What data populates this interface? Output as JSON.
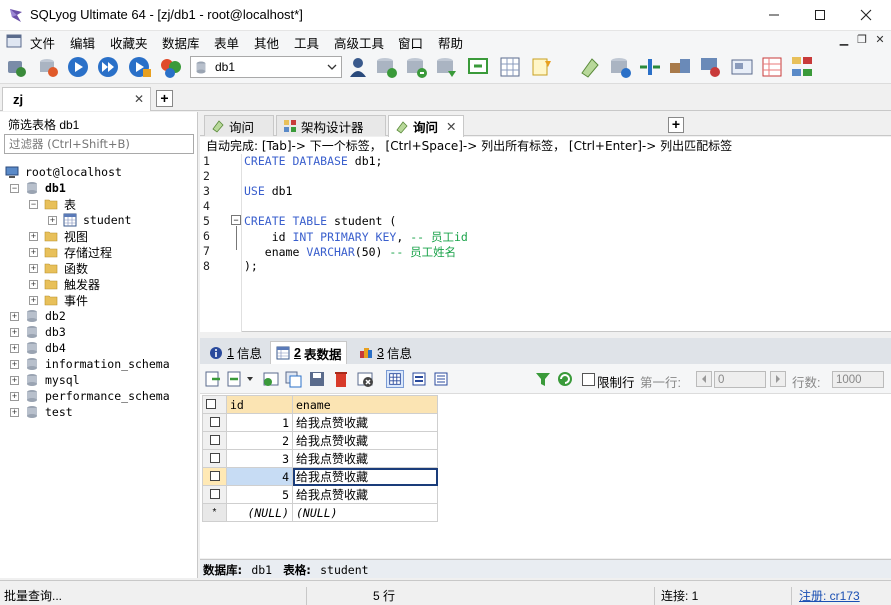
{
  "window": {
    "title": "SQLyog Ultimate 64 - [zj/db1 - root@localhost*]"
  },
  "menu": [
    "文件",
    "编辑",
    "收藏夹",
    "数据库",
    "表单",
    "其他",
    "工具",
    "高级工具",
    "窗口",
    "帮助"
  ],
  "toolbar": {
    "database_select": "db1"
  },
  "connection_tab": {
    "label": "zj",
    "close": "✕",
    "add": "+"
  },
  "object_browser": {
    "filter_label": "筛选表格 db1",
    "filter_placeholder": "过滤器 (Ctrl+Shift+B)",
    "root": "root@localhost",
    "db1": "db1",
    "folder_tables": "表",
    "table_student": "student",
    "folder_views": "视图",
    "folder_procs": "存储过程",
    "folder_funcs": "函数",
    "folder_triggers": "触发器",
    "folder_events": "事件",
    "databases": [
      "db2",
      "db3",
      "db4",
      "information_schema",
      "mysql",
      "performance_schema",
      "test"
    ]
  },
  "query_tabs": {
    "tab1": "询问",
    "tab2": "架构设计器",
    "tab3": "询问",
    "add": "+"
  },
  "autocomplete_hint": "自动完成:  [Tab]-> 下一个标签，  [Ctrl+Space]-> 列出所有标签，  [Ctrl+Enter]-> 列出匹配标签",
  "editor": {
    "line_numbers": [
      "1",
      "2",
      "3",
      "4",
      "5",
      "6",
      "7",
      "8"
    ],
    "lines": {
      "l1_kw": "CREATE DATABASE",
      "l1_rest": " db1;",
      "l3_kw": "USE",
      "l3_rest": " db1",
      "l5_kw": "CREATE TABLE",
      "l5_rest": " student (",
      "l6_a": "    id ",
      "l6_kw": "INT PRIMARY KEY",
      "l6_b": ", ",
      "l6_cm": "-- 员工id",
      "l7_a": "   ename ",
      "l7_kw": "VARCHAR",
      "l7_b": "(50) ",
      "l7_cm": "-- 员工姓名",
      "l8": ");"
    }
  },
  "result_tabs": {
    "t1_num": "1",
    "t1_label": "信息",
    "t2_num": "2",
    "t2_label": "表数据",
    "t3_num": "3",
    "t3_label": "信息"
  },
  "result_toolbar": {
    "limit_rows": "限制行",
    "first_row_label": "第一行:",
    "first_row_value": "0",
    "rows_label": "行数:",
    "rows_value": "1000"
  },
  "grid": {
    "columns": [
      "id",
      "ename"
    ],
    "rows": [
      {
        "id": "1",
        "ename": "给我点赞收藏"
      },
      {
        "id": "2",
        "ename": "给我点赞收藏"
      },
      {
        "id": "3",
        "ename": "给我点赞收藏"
      },
      {
        "id": "4",
        "ename": "给我点赞收藏"
      },
      {
        "id": "5",
        "ename": "给我点赞收藏"
      }
    ],
    "new_row_marker": "*",
    "null_id": "(NULL)",
    "null_ename": "(NULL)"
  },
  "info_bar": {
    "db_label": "数据库:",
    "db_value": "db1",
    "table_label": "表格:",
    "table_value": "student"
  },
  "status": {
    "left": "批量查询...",
    "rows": "5 行",
    "connection": "连接: 1",
    "register": "注册:  cr173"
  },
  "colors": {
    "keyword": "#3a5fcd",
    "comment": "#1aa34a",
    "header_bg": "#fbe4b3",
    "selection": "#c7dcf4"
  }
}
